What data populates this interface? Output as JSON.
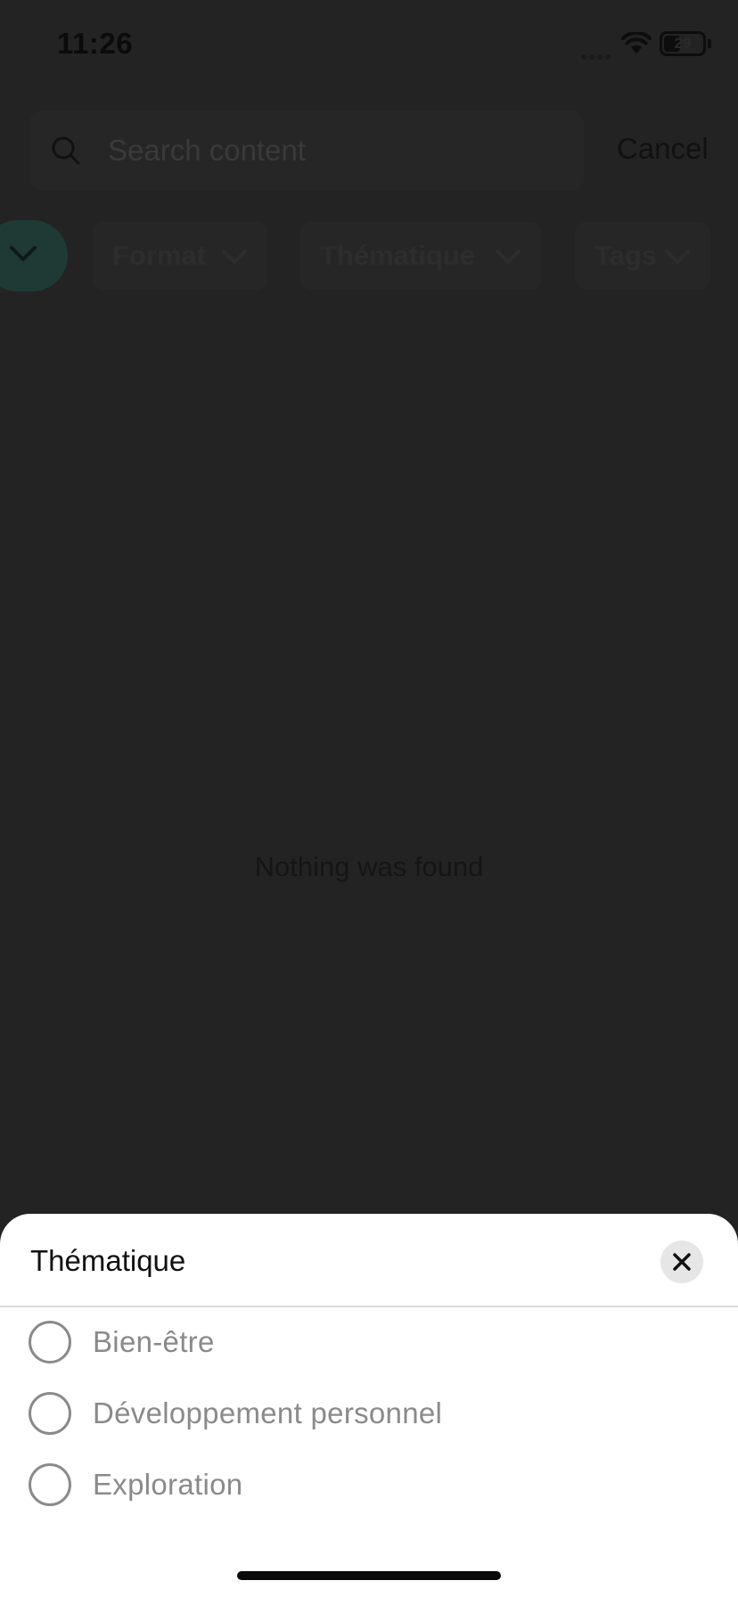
{
  "status_bar": {
    "time": "11:26",
    "battery": "29"
  },
  "search": {
    "placeholder": "Search content",
    "cancel_label": "Cancel"
  },
  "filters": {
    "chips": [
      {
        "label": "Format"
      },
      {
        "label": "Thématique"
      },
      {
        "label": "Tags"
      }
    ]
  },
  "results": {
    "empty_message": "Nothing was found"
  },
  "sheet": {
    "title": "Thématique",
    "options": [
      {
        "label": "Bien-être",
        "selected": false
      },
      {
        "label": "Développement personnel",
        "selected": false
      },
      {
        "label": "Exploration",
        "selected": false
      }
    ]
  },
  "colors": {
    "overlay_background": "#232323",
    "sheet_background": "#ffffff",
    "option_text": "#8a8a8a",
    "accent_dimmed": "#1f3a35"
  },
  "icons": {
    "search": "search-icon",
    "close": "close-icon",
    "chevron": "chevron-down-icon",
    "wifi": "wifi-icon",
    "battery": "battery-icon"
  }
}
